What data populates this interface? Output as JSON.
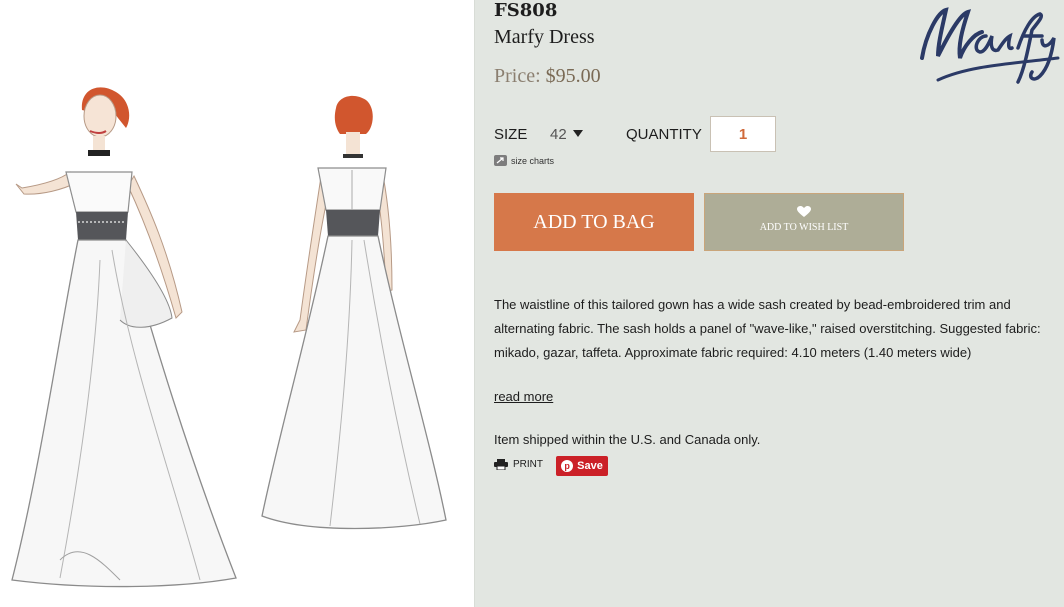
{
  "product": {
    "sku": "FS808",
    "name": "Marfy Dress",
    "price_label": "Price:",
    "price_value": "$95.00"
  },
  "brand": {
    "logo_text": "Marfy"
  },
  "options": {
    "size_label": "SIZE",
    "size_value": "42",
    "quantity_label": "QUANTITY",
    "quantity_value": "1",
    "size_charts_label": "size charts"
  },
  "actions": {
    "add_to_bag": "ADD TO BAG",
    "add_to_wishlist": "ADD TO WISH LIST",
    "read_more": "read more",
    "print": "PRINT",
    "save": "Save"
  },
  "description": "The waistline of this tailored gown has a wide sash created by bead-embroidered trim and alternating fabric. The sash holds a panel of \"wave-like,\" raised overstitching. Suggested fabric: mikado, gazar, taffeta. Approximate fabric required: 4.10 meters (1.40 meters wide)",
  "shipping_note": "Item shipped within the U.S. and Canada only.",
  "colors": {
    "add_to_bag_bg": "#d6784a",
    "wishlist_bg": "#aead97",
    "pinterest_red": "#cb2027",
    "page_bg": "#e2e6e1",
    "logo_navy": "#2b3a66"
  },
  "icons": [
    "heart-icon",
    "external-link-icon",
    "printer-icon",
    "pinterest-icon",
    "dropdown-arrow-icon"
  ]
}
